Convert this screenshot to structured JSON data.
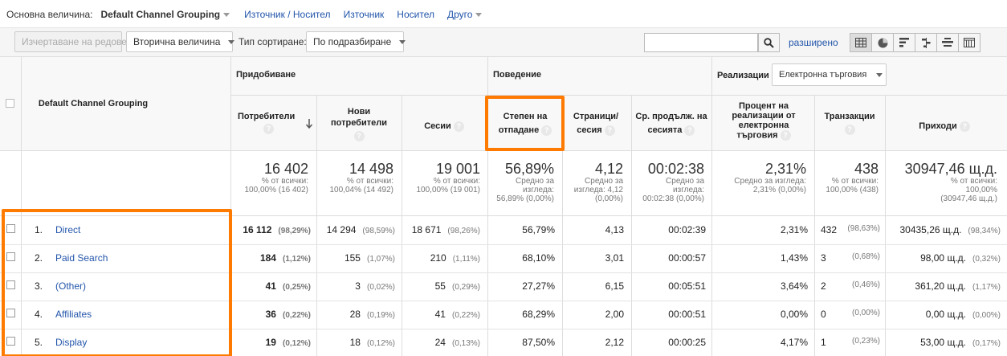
{
  "dimension_bar": {
    "label": "Основна величина:",
    "current": "Default Channel Grouping",
    "links": [
      "Източник / Носител",
      "Източник",
      "Носител",
      "Друго"
    ]
  },
  "toolbar": {
    "plot_rows": "Изчертаване на редовете",
    "secondary": "Вторична величина",
    "sort_label": "Тип сортиране:",
    "sort_value": "По подразбиране",
    "search_placeholder": "",
    "advanced": "разширено"
  },
  "table": {
    "dim_header": "Default Channel Grouping",
    "groups": {
      "acquisition": "Придобиване",
      "behavior": "Поведение",
      "conversions": "Реализации",
      "conversions_select": "Електронна търговия"
    },
    "columns": {
      "users": "Потребители",
      "new_users": "Нови потребители",
      "sessions": "Сесии",
      "bounce": "Степен на отпадане",
      "pages": "Страници/ сесия",
      "duration": "Ср. продълж. на сесията",
      "conv_rate": "Процент на реализации от електронна търговия",
      "transactions": "Транзакции",
      "revenue": "Приходи"
    },
    "totals": {
      "users": {
        "big": "16 402",
        "sub1": "% от всички:",
        "sub2": "100,00% (16 402)"
      },
      "new_users": {
        "big": "14 498",
        "sub1": "% от всички:",
        "sub2": "100,04% (14 492)"
      },
      "sessions": {
        "big": "19 001",
        "sub1": "% от всички:",
        "sub2": "100,00% (19 001)"
      },
      "bounce": {
        "big": "56,89%",
        "sub1": "Средно за",
        "sub2": "изгледа:",
        "sub3": "56,89% (0,00%)"
      },
      "pages": {
        "big": "4,12",
        "sub1": "Средно за",
        "sub2": "изгледа: 4,12",
        "sub3": "(0,00%)"
      },
      "duration": {
        "big": "00:02:38",
        "sub1": "Средно за",
        "sub2": "изгледа:",
        "sub3": "00:02:38 (0,00%)"
      },
      "conv_rate": {
        "big": "2,31%",
        "sub1": "Средно за изгледа:",
        "sub2": "2,31% (0,00%)"
      },
      "transactions": {
        "big": "438",
        "sub1": "% от всички:",
        "sub2": "100,00% (438)"
      },
      "revenue": {
        "big": "30947,46 щ.д.",
        "sub1": "% от всички:",
        "sub2": "100,00%",
        "sub3": "(30947,46 щ.д.)"
      }
    },
    "rows": [
      {
        "n": "1.",
        "name": "Direct",
        "users": "16 112",
        "users_p": "(98,29%)",
        "new": "14 294",
        "new_p": "(98,59%)",
        "sess": "18 671",
        "sess_p": "(98,26%)",
        "bounce": "56,79%",
        "pages": "4,13",
        "dur": "00:02:39",
        "conv": "2,31%",
        "tr": "432",
        "tr_p": "(98,63%)",
        "rev": "30435,26 щ.д.",
        "rev_p": "(98,34%)"
      },
      {
        "n": "2.",
        "name": "Paid Search",
        "users": "184",
        "users_p": "(1,12%)",
        "new": "155",
        "new_p": "(1,07%)",
        "sess": "210",
        "sess_p": "(1,11%)",
        "bounce": "68,10%",
        "pages": "3,01",
        "dur": "00:00:57",
        "conv": "1,43%",
        "tr": "3",
        "tr_p": "(0,68%)",
        "rev": "98,00 щ.д.",
        "rev_p": "(0,32%)"
      },
      {
        "n": "3.",
        "name": "(Other)",
        "users": "41",
        "users_p": "(0,25%)",
        "new": "3",
        "new_p": "(0,02%)",
        "sess": "55",
        "sess_p": "(0,29%)",
        "bounce": "27,27%",
        "pages": "6,15",
        "dur": "00:05:51",
        "conv": "3,64%",
        "tr": "2",
        "tr_p": "(0,46%)",
        "rev": "361,20 щ.д.",
        "rev_p": "(1,17%)"
      },
      {
        "n": "4.",
        "name": "Affiliates",
        "users": "36",
        "users_p": "(0,22%)",
        "new": "28",
        "new_p": "(0,19%)",
        "sess": "41",
        "sess_p": "(0,22%)",
        "bounce": "68,29%",
        "pages": "2,00",
        "dur": "00:00:51",
        "conv": "0,00%",
        "tr": "0",
        "tr_p": "(0,00%)",
        "rev": "0,00 щ.д.",
        "rev_p": "(0,00%)"
      },
      {
        "n": "5.",
        "name": "Display",
        "users": "19",
        "users_p": "(0,12%)",
        "new": "18",
        "new_p": "(0,12%)",
        "sess": "24",
        "sess_p": "(0,13%)",
        "bounce": "87,50%",
        "pages": "2,12",
        "dur": "00:00:25",
        "conv": "4,17%",
        "tr": "1",
        "tr_p": "(0,23%)",
        "rev": "53,00 щ.д.",
        "rev_p": "(0,17%)"
      }
    ]
  },
  "colors": {
    "highlight": "#ff7a00",
    "link": "#2255aa"
  },
  "icons": [
    "search-icon",
    "table-view-icon",
    "pie-view-icon",
    "bar-view-icon",
    "comparison-view-icon",
    "term-cloud-icon",
    "pivot-view-icon",
    "help-icon",
    "sort-down-icon"
  ]
}
